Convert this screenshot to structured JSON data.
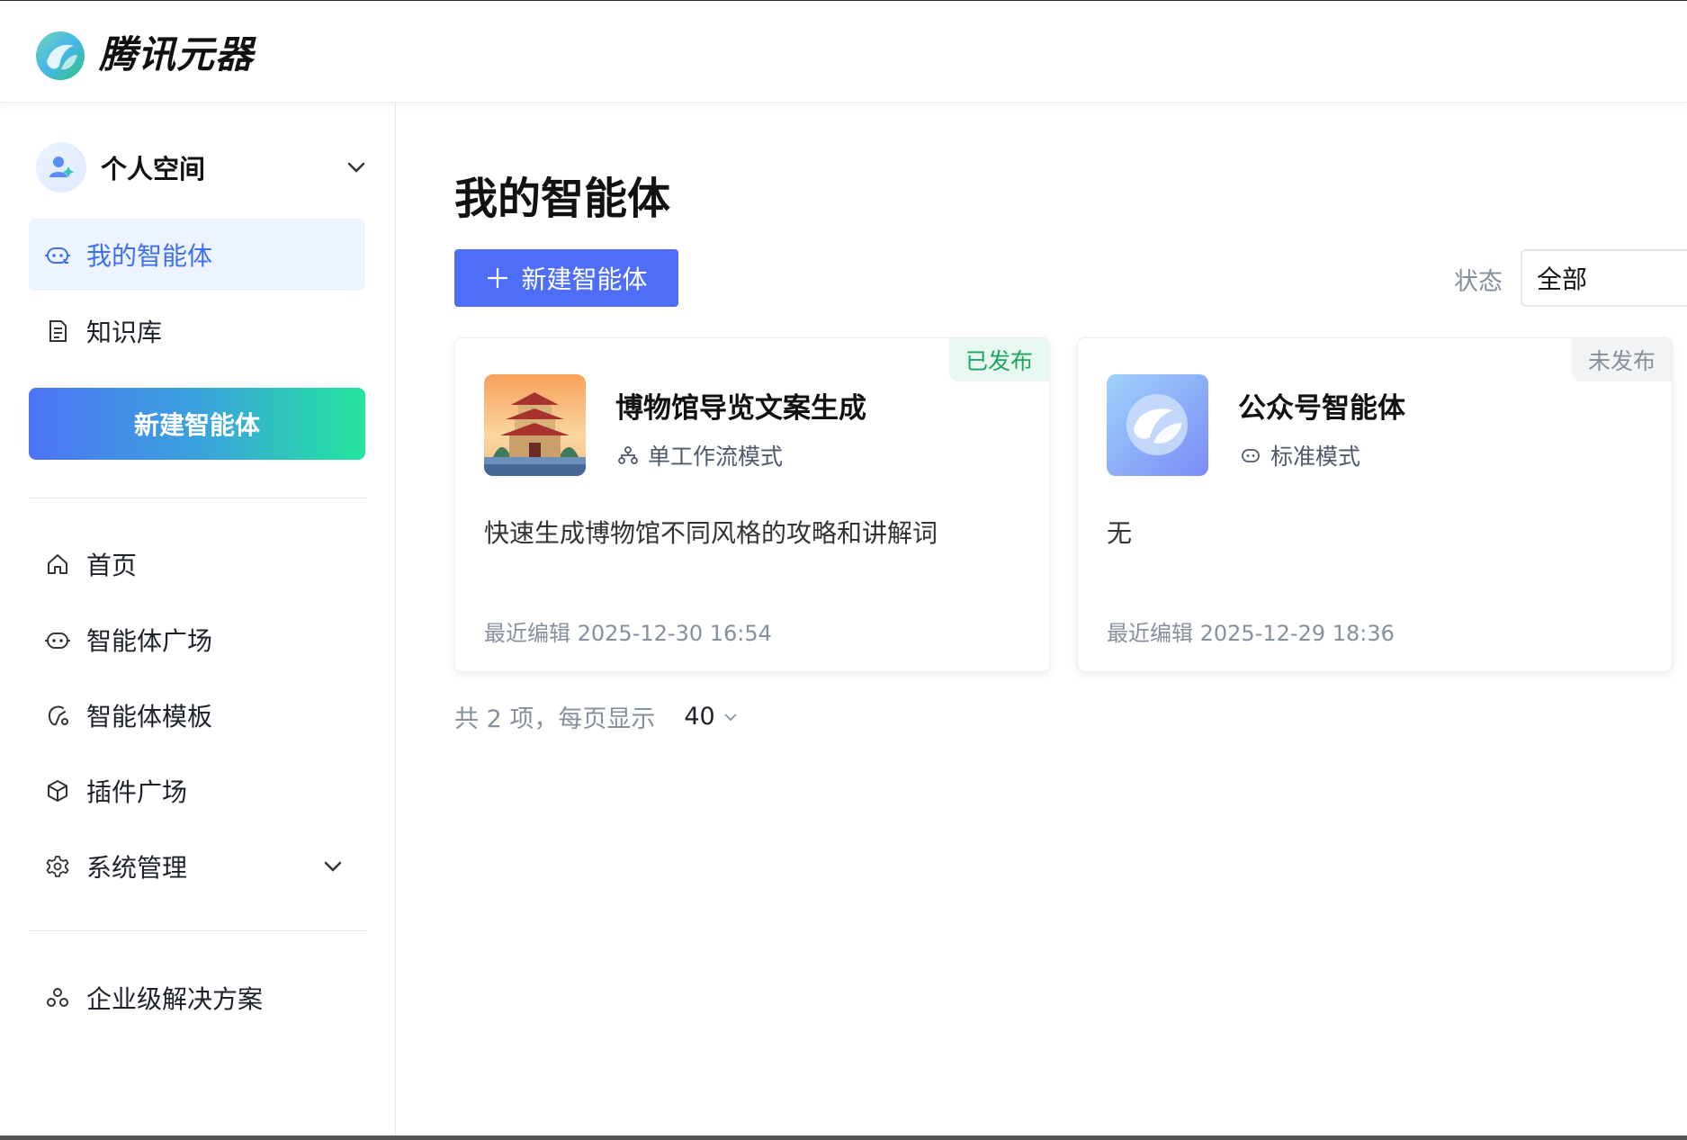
{
  "header": {
    "brand": "腾讯元器"
  },
  "sidebar": {
    "space_label": "个人空间",
    "top_items": [
      {
        "label": "我的智能体",
        "icon": "robot-icon",
        "active": true
      },
      {
        "label": "知识库",
        "icon": "document-icon",
        "active": false
      }
    ],
    "new_agent_label": "新建智能体",
    "nav_items": [
      {
        "label": "首页",
        "icon": "home-icon"
      },
      {
        "label": "智能体广场",
        "icon": "robot-icon"
      },
      {
        "label": "智能体模板",
        "icon": "template-icon"
      },
      {
        "label": "插件广场",
        "icon": "cube-icon"
      },
      {
        "label": "系统管理",
        "icon": "gear-icon"
      }
    ],
    "enterprise_label": "企业级解决方案"
  },
  "main": {
    "title": "我的智能体",
    "create_button": "新建智能体",
    "status_filter": {
      "label": "状态",
      "value": "全部"
    },
    "cards": [
      {
        "name": "博物馆导览文案生成",
        "mode": "单工作流模式",
        "mode_icon": "workflow-icon",
        "description": "快速生成博物馆不同风格的攻略和讲解词",
        "edited": "最近编辑 2025-12-30 16:54",
        "status": "已发布"
      },
      {
        "name": "公众号智能体",
        "mode": "标准模式",
        "mode_icon": "robot-icon",
        "description": "无",
        "edited": "最近编辑 2025-12-29 18:36",
        "status": "未发布"
      }
    ],
    "pagination": {
      "summary": "共 2 项，每页显示",
      "page_size": "40"
    }
  },
  "colors": {
    "accent": "#4e6ef8",
    "active_bg": "#eef4ff",
    "published": "#1fa461",
    "muted": "#86909c"
  }
}
